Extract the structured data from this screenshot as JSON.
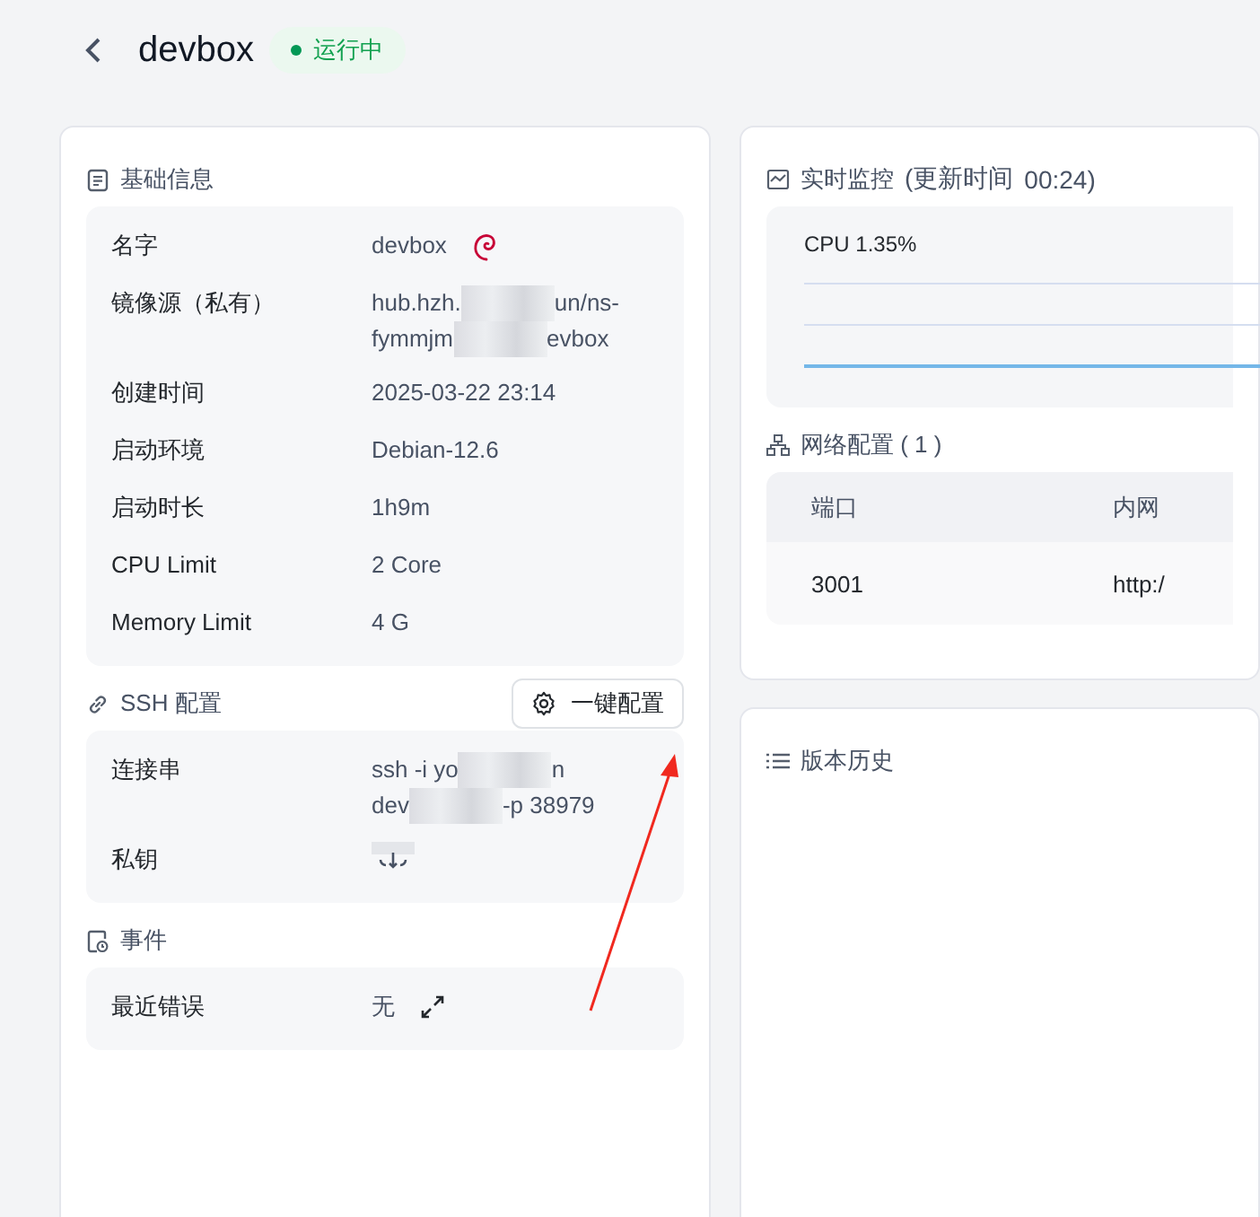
{
  "header": {
    "title": "devbox",
    "status": {
      "label": "运行中",
      "kind": "running"
    }
  },
  "left_sections": [
    {
      "kind": "basic",
      "title": "基础信息",
      "rows": [
        {
          "label": "名字",
          "kind": "logo",
          "lines": [
            [
              {
                "text": "devbox"
              }
            ]
          ]
        },
        {
          "label": "镜像源（私有）",
          "kind": "text",
          "lines": [
            [
              {
                "text": "hub.hzh."
              },
              {
                "kind": "redacted"
              },
              {
                "text": "un/ns-"
              }
            ],
            [
              {
                "text": "fymmjm"
              },
              {
                "kind": "redacted"
              },
              {
                "text": "evbox"
              }
            ]
          ]
        },
        {
          "label": "创建时间",
          "kind": "text",
          "lines": [
            [
              {
                "text": "2025-03-22 23:14"
              }
            ]
          ]
        },
        {
          "label": "启动环境",
          "kind": "text",
          "lines": [
            [
              {
                "text": "Debian-12.6"
              }
            ]
          ]
        },
        {
          "label": "启动时长",
          "kind": "text",
          "lines": [
            [
              {
                "text": "1h9m"
              }
            ]
          ]
        },
        {
          "label": "CPU Limit",
          "kind": "text",
          "lines": [
            [
              {
                "text": "2 Core"
              }
            ]
          ]
        },
        {
          "label": "Memory Limit",
          "kind": "text",
          "lines": [
            [
              {
                "text": "4 G"
              }
            ]
          ]
        }
      ]
    },
    {
      "kind": "ssh",
      "title": "SSH 配置",
      "action": "一键配置",
      "rows": [
        {
          "label": "连接串",
          "kind": "text",
          "lines": [
            [
              {
                "text": "ssh -i yo"
              },
              {
                "kind": "redacted"
              },
              {
                "text": "n"
              }
            ],
            [
              {
                "text": "dev"
              },
              {
                "kind": "redacted"
              },
              {
                "text": "-p 38979"
              }
            ]
          ]
        },
        {
          "label": "私钥",
          "kind": "key",
          "lines": []
        }
      ]
    },
    {
      "kind": "events",
      "title": "事件",
      "rows": [
        {
          "label": "最近错误",
          "kind": "expandable",
          "lines": [
            [
              {
                "text": "无"
              }
            ]
          ]
        }
      ]
    }
  ],
  "monitor": {
    "title": "实时监控",
    "update_label": "(更新时间",
    "update_time": "00:24)",
    "cpu": "CPU 1.35%"
  },
  "network": {
    "title": "网络配置 ( 1 )",
    "columns": [
      "端口",
      "内网"
    ],
    "rows": [
      [
        "3001",
        "http:/"
      ]
    ]
  },
  "history": {
    "title": "版本历史"
  }
}
